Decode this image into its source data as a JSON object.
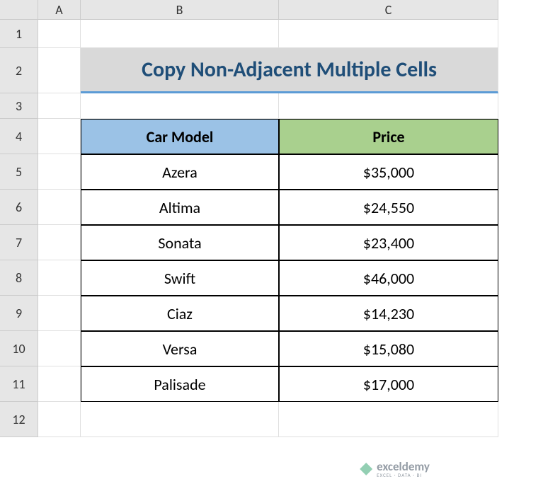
{
  "columns": {
    "A": "A",
    "B": "B",
    "C": "C"
  },
  "rows": {
    "r1": "1",
    "r2": "2",
    "r3": "3",
    "r4": "4",
    "r5": "5",
    "r6": "6",
    "r7": "7",
    "r8": "8",
    "r9": "9",
    "r10": "10",
    "r11": "11",
    "r12": "12"
  },
  "title": "Copy Non-Adjacent Multiple Cells",
  "table": {
    "headers": {
      "model": "Car Model",
      "price": "Price"
    },
    "data": [
      {
        "model": "Azera",
        "price": "$35,000"
      },
      {
        "model": "Altima",
        "price": "$24,550"
      },
      {
        "model": "Sonata",
        "price": "$23,400"
      },
      {
        "model": "Swift",
        "price": "$46,000"
      },
      {
        "model": "Ciaz",
        "price": "$14,230"
      },
      {
        "model": "Versa",
        "price": "$15,080"
      },
      {
        "model": "Palisade",
        "price": "$17,000"
      }
    ]
  },
  "watermark": {
    "name": "exceldemy",
    "tagline": "EXCEL · DATA · BI"
  }
}
